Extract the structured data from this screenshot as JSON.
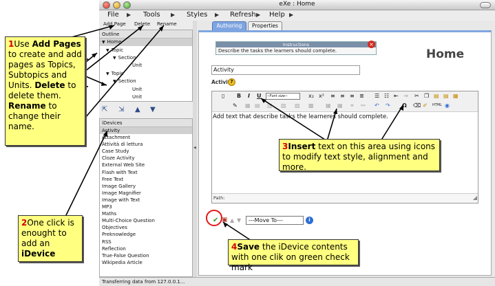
{
  "window": {
    "title": "eXe : Home"
  },
  "menu": [
    {
      "label": "File"
    },
    {
      "label": "Tools"
    },
    {
      "label": "Styles"
    },
    {
      "label": "Refresh"
    },
    {
      "label": "Help"
    }
  ],
  "outline_toolbar": {
    "add_page": "Add Page",
    "delete": "Delete",
    "rename": "Rename"
  },
  "outline": {
    "header": "Outline",
    "nodes": [
      {
        "label": "Home"
      },
      {
        "label": "Topic"
      },
      {
        "label": "Section"
      },
      {
        "label": "Unit"
      },
      {
        "label": "Topic"
      },
      {
        "label": "Section"
      },
      {
        "label": "Unit"
      },
      {
        "label": "Unit"
      }
    ]
  },
  "idevices": {
    "header": "iDevices",
    "items": [
      "Activity",
      "Attachment",
      "Attività di lettura",
      "Case Study",
      "Cloze Activity",
      "External Web Site",
      "Flash with Text",
      "Free Text",
      "Image Gallery",
      "Image Magnifier",
      "Image with Text",
      "MP3",
      "Maths",
      "Multi-Choice Question",
      "Objectives",
      "Preknowledge",
      "RSS",
      "Reflection",
      "True-False Question",
      "Wikipedia Article"
    ]
  },
  "tabs": {
    "authoring": "Authoring",
    "properties": "Properties"
  },
  "instructions": {
    "title": "Instructions",
    "text": "Describe the tasks the learners should complete."
  },
  "page_heading": "Home",
  "idevice_form": {
    "title_value": "Activity",
    "field_label": "Activity",
    "font_size_select": "--Font size--",
    "editor_text": "Add text that describe tasks the learneres should complete.",
    "path_label": "Path:",
    "move_to": "---Move To---"
  },
  "callouts": {
    "c1": {
      "num": "1",
      "part1": "Use ",
      "bold1": "Add Pages",
      "part2": " to create and add pages as Topics, Subtopics and Units. ",
      "bold2": "Delete",
      "part3": " to delete them. ",
      "bold3": "Rename",
      "part4": " to change their name."
    },
    "c2": {
      "num": "2",
      "part1": "One click is enought to add an ",
      "bold1": "iDevice"
    },
    "c3": {
      "num": "3",
      "bold1": "Insert",
      "part1": " text on this area using icons to modify text style, alignment and more."
    },
    "c4": {
      "num": "4",
      "bold1": "Save",
      "part1": " the iDevice contents with one clik on green check mark"
    }
  },
  "status": "Transferring data from 127.0.0.1..."
}
